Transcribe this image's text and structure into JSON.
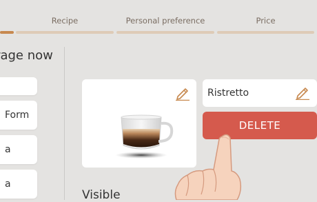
{
  "tabs": [
    {
      "label": "",
      "active": true
    },
    {
      "label": "Recipe",
      "active": false
    },
    {
      "label": "Personal preference",
      "active": false
    },
    {
      "label": "Price",
      "active": false
    }
  ],
  "sidebar": {
    "title": "erage now",
    "items": [
      "",
      "Form",
      "a",
      "a"
    ]
  },
  "recipe_card": {
    "image_icon": "espresso-cup-icon",
    "edit_icon": "pencil-icon"
  },
  "name_card": {
    "label": "Ristretto",
    "edit_icon": "pencil-icon"
  },
  "delete_button": {
    "label": "DELETE"
  },
  "visible_label": "Visible",
  "colors": {
    "background": "#e4e3e1",
    "accent": "#c7894f",
    "tab_inactive": "#decbb7",
    "delete": "#d55a4d",
    "card": "#ffffff"
  }
}
